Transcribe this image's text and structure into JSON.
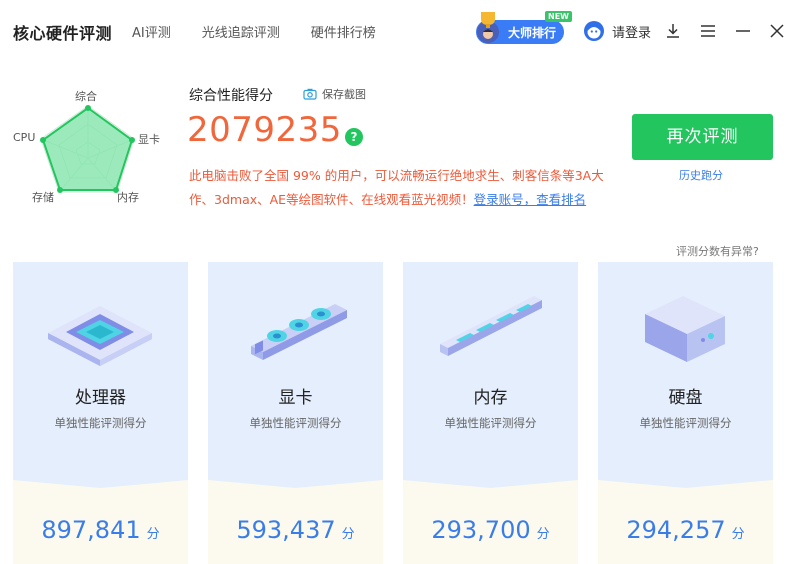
{
  "header": {
    "title": "核心硬件评测",
    "tabs": [
      {
        "label": "AI评测"
      },
      {
        "label": "光线追踪评测"
      },
      {
        "label": "硬件排行榜"
      }
    ],
    "master_rank": {
      "label": "大师排行",
      "new_tag": "NEW"
    },
    "login_label": "请登录"
  },
  "summary": {
    "title": "综合性能得分",
    "save_screenshot": "保存截图",
    "total_score": "2079235",
    "help_icon": "?",
    "description": "此电脑击败了全国 99% 的用户，可以流畅运行绝地求生、刺客信条等3A大作、3dmax、AE等绘图软件、在线观看蓝光视频！",
    "login_link": "登录账号，查看排名",
    "retest_button": "再次评测",
    "history_link": "历史跑分",
    "abnormal_link": "评测分数有异常?"
  },
  "radar": {
    "labels": {
      "overall": "综合",
      "gpu": "显卡",
      "memory": "内存",
      "storage": "存储",
      "cpu": "CPU"
    }
  },
  "cards": [
    {
      "title": "处理器",
      "subtitle": "单独性能评测得分",
      "score": "897,841",
      "unit": "分",
      "icon": "cpu-chip-icon"
    },
    {
      "title": "显卡",
      "subtitle": "单独性能评测得分",
      "score": "593,437",
      "unit": "分",
      "icon": "graphics-card-icon"
    },
    {
      "title": "内存",
      "subtitle": "单独性能评测得分",
      "score": "293,700",
      "unit": "分",
      "icon": "memory-stick-icon"
    },
    {
      "title": "硬盘",
      "subtitle": "单独性能评测得分",
      "score": "294,257",
      "unit": "分",
      "icon": "hard-drive-icon"
    }
  ],
  "colors": {
    "accent_green": "#22c55e",
    "score_orange": "#f0673c",
    "link_blue": "#3b7de8",
    "card_top": "#e5eefc",
    "card_bottom": "#fcfaee"
  }
}
